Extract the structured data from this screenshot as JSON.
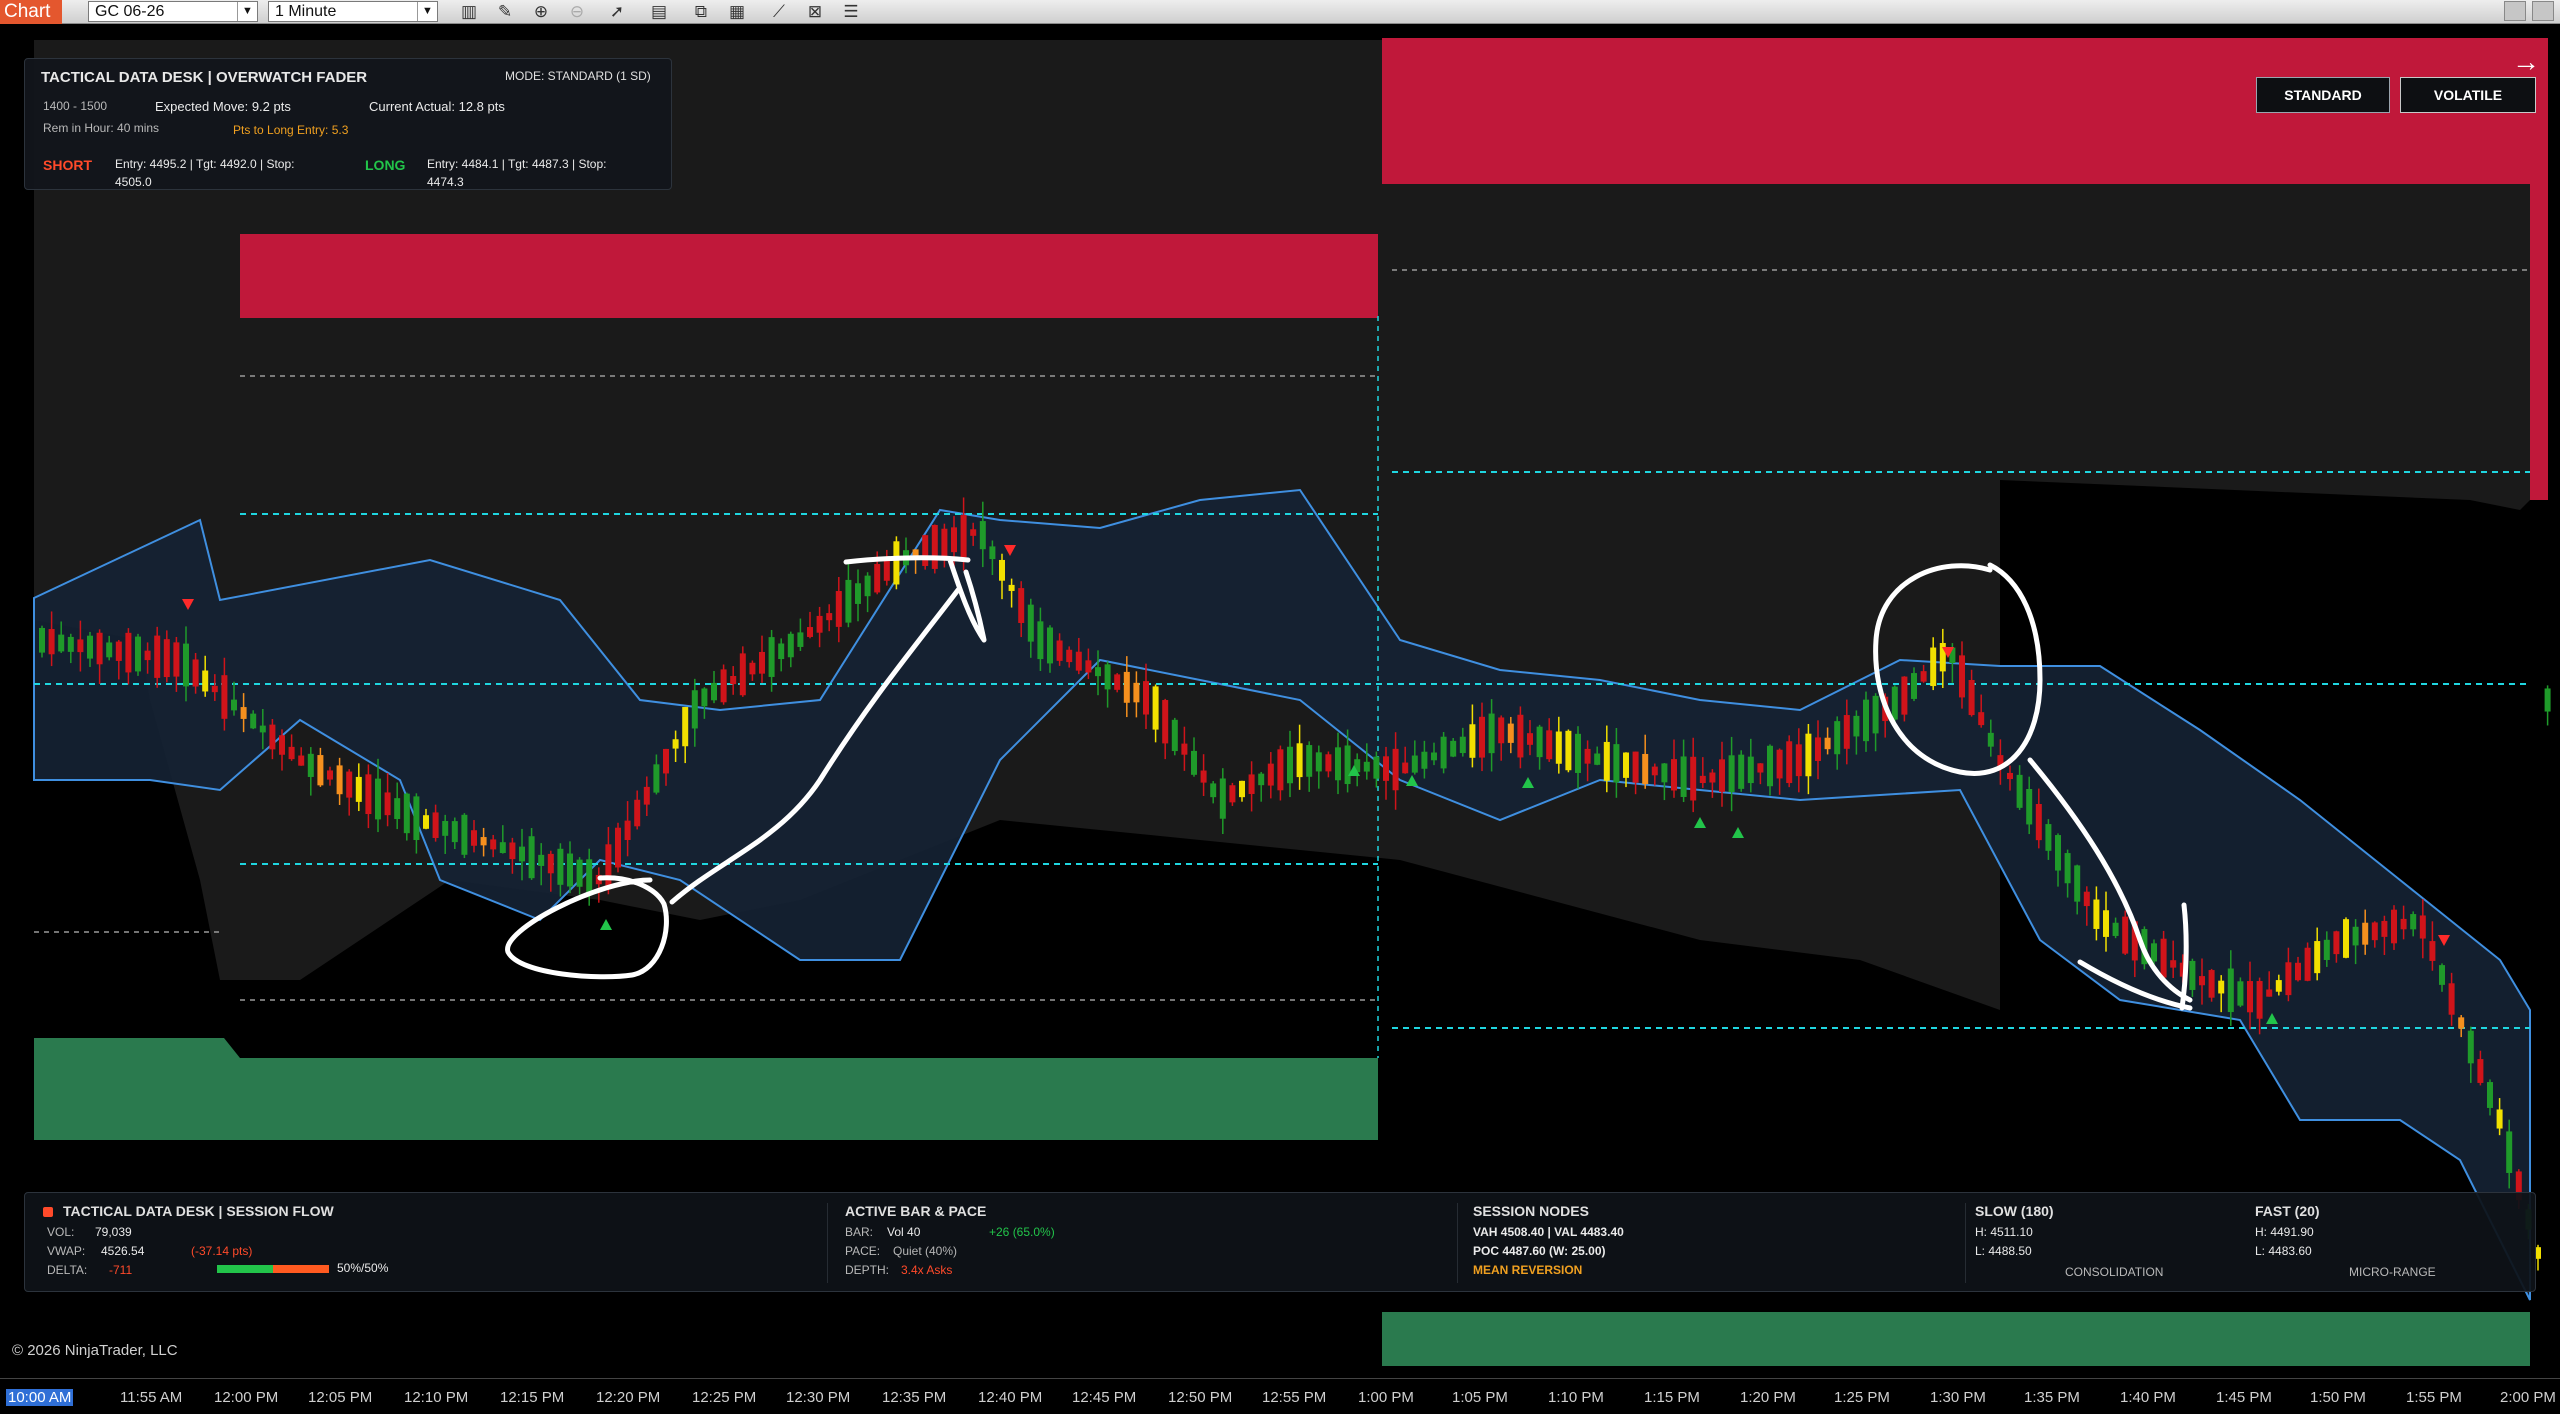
{
  "toolbar": {
    "tab": "Chart",
    "instrument": "GC 06-26",
    "interval": "1 Minute"
  },
  "top_panel": {
    "title": "TACTICAL DATA DESK  |  OVERWATCH FADER",
    "mode": "MODE: STANDARD (1 SD)",
    "hour_range": "1400 - 1500",
    "expected_move": "Expected Move: 9.2 pts",
    "current_actual": "Current Actual: 12.8 pts",
    "rem_in_hour": "Rem in Hour: 40 mins",
    "pts_to_long": "Pts to Long Entry: 5.3",
    "short_label": "SHORT",
    "short_detail_1": "Entry: 4495.2  |  Tgt: 4492.0  |  Stop:",
    "short_detail_2": "4505.0",
    "long_label": "LONG",
    "long_detail_1": "Entry: 4484.1  |  Tgt: 4487.3  |  Stop:",
    "long_detail_2": "4474.3"
  },
  "mode_buttons": {
    "standard": "STANDARD",
    "volatile": "VOLATILE"
  },
  "bottom_panel": {
    "flow_title": "TACTICAL DATA DESK  |  SESSION FLOW",
    "vol_label": "VOL:",
    "vol_value": "79,039",
    "vwap_label": "VWAP:",
    "vwap_value": "4526.54",
    "vwap_diff": "(-37.14 pts)",
    "delta_label": "DELTA:",
    "delta_value": "-711",
    "delta_ratio": "50%/50%",
    "delta_buy_fraction": 0.5,
    "active_title": "ACTIVE BAR & PACE",
    "bar_label": "BAR:",
    "bar_value": "Vol 40",
    "bar_change": "+26 (65.0%)",
    "pace_label": "PACE:",
    "pace_value": "Quiet (40%)",
    "depth_label": "DEPTH:",
    "depth_value": "3.4x Asks",
    "nodes_title": "SESSION NODES",
    "vah_val": "VAH 4508.40  |  VAL 4483.40",
    "poc": "POC 4487.60 (W: 25.00)",
    "regime": "MEAN REVERSION",
    "slow_title": "SLOW (180)",
    "slow_h": "H: 4511.10",
    "slow_l": "L: 4488.50",
    "slow_state": "CONSOLIDATION",
    "fast_title": "FAST (20)",
    "fast_h": "H: 4491.90",
    "fast_l": "L: 4483.60",
    "fast_state": "MICRO-RANGE"
  },
  "copyright": "© 2026 NinjaTrader, LLC",
  "time_axis": [
    "10:00 AM",
    "11:55 AM",
    "12:00 PM",
    "12:05 PM",
    "12:10 PM",
    "12:15 PM",
    "12:20 PM",
    "12:25 PM",
    "12:30 PM",
    "12:35 PM",
    "12:40 PM",
    "12:45 PM",
    "12:50 PM",
    "12:55 PM",
    "1:00 PM",
    "1:05 PM",
    "1:10 PM",
    "1:15 PM",
    "1:20 PM",
    "1:25 PM",
    "1:30 PM",
    "1:35 PM",
    "1:40 PM",
    "1:45 PM",
    "1:50 PM",
    "1:55 PM",
    "2:00 PM"
  ],
  "colors": {
    "short_zone": "#c0183a",
    "long_zone": "#2a7a4e",
    "band_fill": "#152234",
    "band_line": "#3f8fe0",
    "dashed_cyan": "#1fd6e0",
    "outer_band": "#1a1a1a",
    "up_candle": "#1f9a2a",
    "down_candle": "#d0141a",
    "doji_yellow": "#f2e000",
    "doji_orange": "#f5901e",
    "annotation": "#ffffff"
  }
}
